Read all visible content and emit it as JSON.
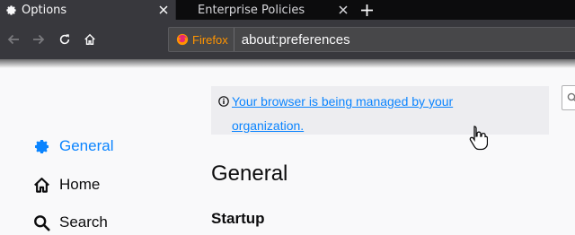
{
  "tabs": [
    {
      "label": "Options",
      "selected": true,
      "icon": "gear-icon"
    },
    {
      "label": "Enterprise Policies",
      "selected": false,
      "icon": ""
    }
  ],
  "navbar": {
    "identity_label": "Firefox",
    "url": "about:preferences"
  },
  "banner": {
    "link_text": "Your browser is being managed by your organization."
  },
  "sidebar": {
    "items": [
      {
        "label": "General",
        "icon": "gear-icon",
        "selected": true
      },
      {
        "label": "Home",
        "icon": "home-icon",
        "selected": false
      },
      {
        "label": "Search",
        "icon": "search-icon",
        "selected": false
      }
    ]
  },
  "pane": {
    "title": "General",
    "section_title": "Startup"
  },
  "colors": {
    "accent": "#0a84ff",
    "tab_strip": "#0c0c0d",
    "toolbar": "#38383d",
    "identity": "#ff9400",
    "banner_bg": "#ededf0"
  }
}
